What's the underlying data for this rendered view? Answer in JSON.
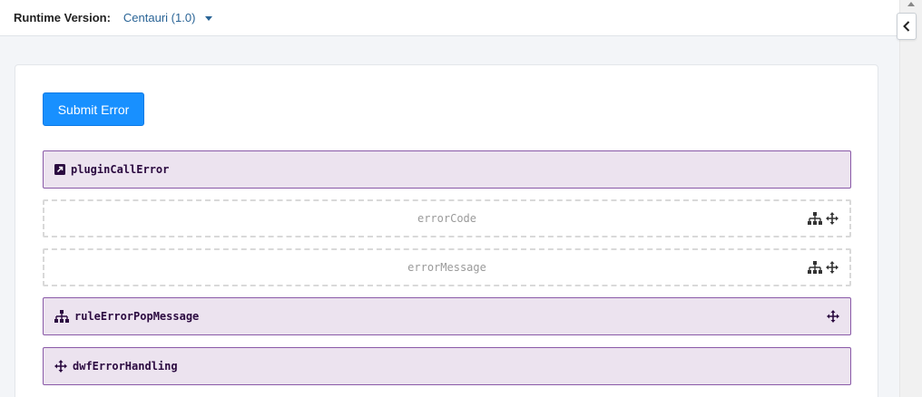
{
  "header": {
    "runtime_label": "Runtime Version:",
    "runtime_value": "Centauri (1.0)"
  },
  "actions": {
    "submit_label": "Submit Error"
  },
  "blocks": [
    {
      "label": "pluginCallError",
      "style": "solid",
      "icon": "external-link-icon"
    },
    {
      "label": "errorCode",
      "style": "dashed",
      "icons": [
        "sitemap-icon",
        "move-icon"
      ]
    },
    {
      "label": "errorMessage",
      "style": "dashed",
      "icons": [
        "sitemap-icon",
        "move-icon"
      ]
    },
    {
      "label": "ruleErrorPopMessage",
      "style": "solid",
      "icon": "sitemap-icon",
      "icons": [
        "move-icon"
      ]
    },
    {
      "label": "dwfErrorHandling",
      "style": "solid",
      "icon": "move-icon"
    }
  ],
  "colors": {
    "accent": "#1890ff",
    "block_border": "#8a5aa8",
    "block_fill": "#ece3ef",
    "block_text": "#2b0a40"
  }
}
